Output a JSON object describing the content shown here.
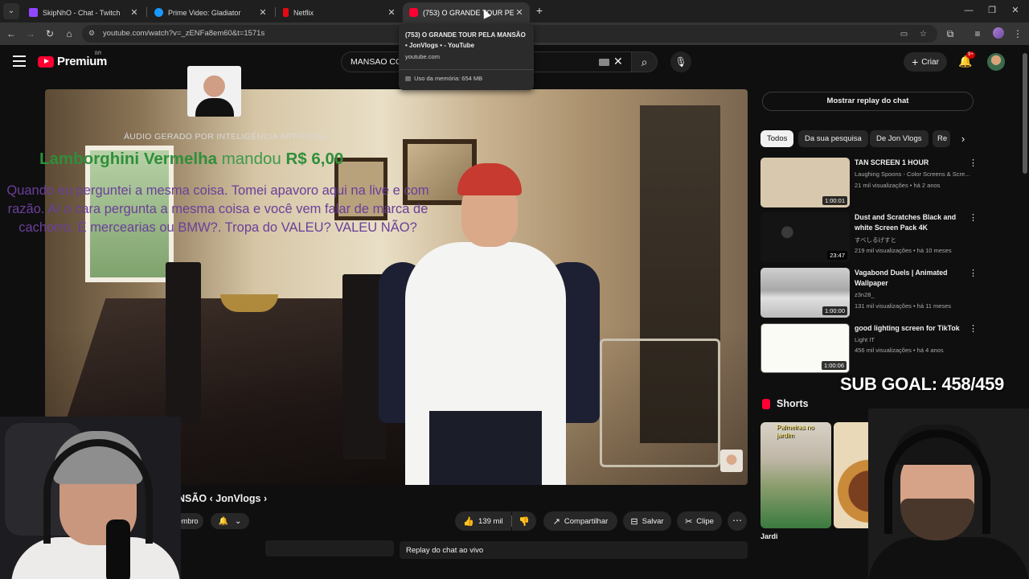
{
  "browser": {
    "tabs": [
      {
        "title": "SkipNhO - Chat - Twitch",
        "favicon_color": "#9146ff"
      },
      {
        "title": "Prime Video: Gladiator",
        "favicon_color": "#1a98ff"
      },
      {
        "title": "Netflix",
        "favicon_color": "#e50914"
      },
      {
        "title": "(753) O GRANDE TOUR PELA M",
        "favicon_color": "#ff0033"
      }
    ],
    "url": "youtube.com/watch?v=_zENFa8em60&t=1571s",
    "hover_card": {
      "title": "(753) O GRANDE TOUR PELA MANSÃO • JonVlogs • - YouTube",
      "domain": "youtube.com",
      "memory": "Uso da memória: 654 MB"
    }
  },
  "header": {
    "logo_text": "Premium",
    "logo_country": "BR",
    "search_query": "MANSAO CO",
    "create_label": "Criar",
    "notification_badge": "9+"
  },
  "player": {
    "ai_label": "ÁUDIO GERADO POR INTELIGÊNCIA ARTIFICIAL",
    "donation_name": "Lamborghini Vermelha",
    "donation_mid": "mandou",
    "donation_amount": "R$ 6,00",
    "donation_message": "Quando eu perguntei a mesma coisa. Tomei apavoro aqui na live e com razão. Aí o cara pergunta a mesma coisa e você vem falar de marca de cachorro. É mercearias ou BMW?. Tropa do VALEU? VALEU NÃO?"
  },
  "video": {
    "title_visible": "ANSÃO ‹ JonVlogs ›",
    "member_label": "membro",
    "likes": "139 mil",
    "share_label": "Compartilhar",
    "save_label": "Salvar",
    "clip_label": "Clipe",
    "chat_replay_label": "Replay do chat ao vivo"
  },
  "sidebar": {
    "show_chat_label": "Mostrar replay do chat",
    "chips": [
      "Todos",
      "Da sua pesquisa",
      "De Jon Vlogs",
      "Re"
    ],
    "recommendations": [
      {
        "title": "TAN SCREEN 1 HOUR",
        "channel": "Laughing Spoons - Color Screens & Scre...",
        "meta": "21 mil visualizações • há 2 anos",
        "duration": "1:00:01"
      },
      {
        "title": "Dust and Scratches Black and white Screen Pack 4K",
        "channel": "すべしるげすと",
        "meta": "219 mil visualizações • há 10 meses",
        "duration": "23:47"
      },
      {
        "title": "Vagabond Duels | Animated Wallpaper",
        "channel": "z3n28_",
        "meta": "131 mil visualizações • há 11 meses",
        "duration": "1:00:00"
      },
      {
        "title": "good lighting screen for TikTok",
        "channel": "Light IT",
        "meta": "456 mil visualizações • há 4 anos",
        "duration": "1:00:06"
      }
    ],
    "shorts_label": "Shorts",
    "short1_caption": "Palmeiras no jardim",
    "short_title_cut": "Jardi"
  },
  "overlay": {
    "sub_goal": "SUB GOAL: 458/459"
  },
  "colors": {
    "yt_red": "#ff0033",
    "donation_green": "#2f8f3a",
    "donation_purple": "#6a3f9a"
  }
}
